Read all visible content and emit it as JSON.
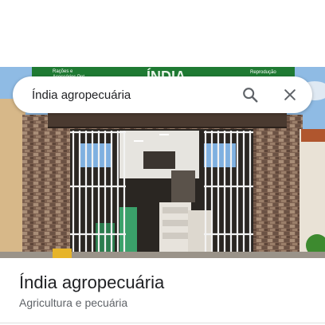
{
  "search": {
    "query": "Índia agropecuária"
  },
  "photo": {
    "sign_left_text_1": "Rações e",
    "sign_left_text_2": "Acessórios Pet",
    "sign_brand_text": "ÍNDIA",
    "sign_right_text": "Reprodução",
    "colors": {
      "sign_green": "#1f7a33",
      "brick": "#8a6f5e",
      "sky": "#8fbbe4"
    }
  },
  "place": {
    "name": "Índia agropecuária",
    "category": "Agricultura e pecuária"
  },
  "icons": {
    "search": "search-icon",
    "close": "close-icon"
  }
}
